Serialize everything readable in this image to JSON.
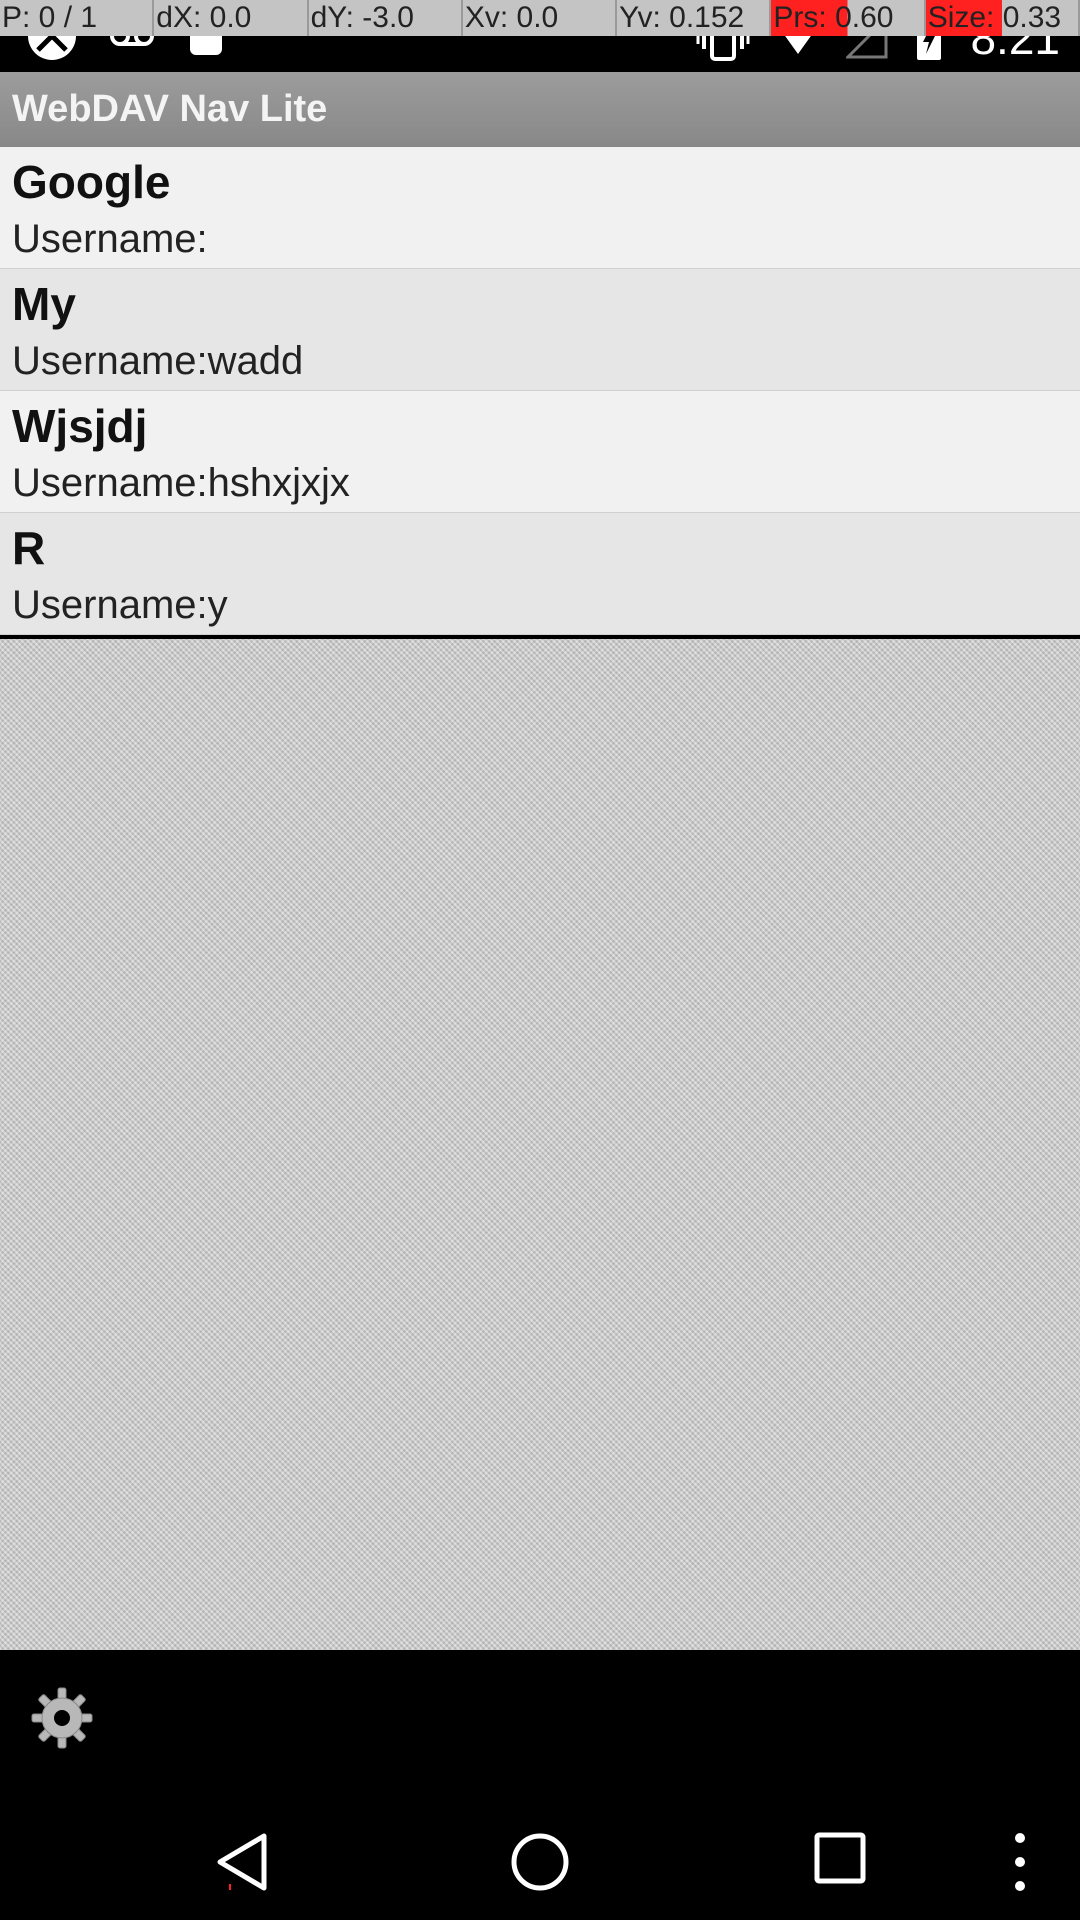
{
  "debug_overlay": [
    "P: 0 / 1",
    "dX: 0.0",
    "dY: -3.0",
    "Xv: 0.0",
    "Yv: 0.152",
    "Prs: 0.60",
    "Size: 0.33"
  ],
  "status_bar": {
    "time": "8:21",
    "left_icons": [
      "app-icon",
      "voicemail-icon",
      "android-icon"
    ],
    "right_icons": [
      "vibrate-icon",
      "wifi-icon",
      "signal-icon",
      "battery-charging-icon"
    ]
  },
  "app": {
    "title": "WebDAV Nav Lite"
  },
  "accounts": [
    {
      "name": "Google",
      "username": "Username:"
    },
    {
      "name": "My",
      "username": "Username:wadd"
    },
    {
      "name": "Wjsjdj",
      "username": "Username:hshxjxjx"
    },
    {
      "name": "R",
      "username": "Username:y"
    }
  ],
  "bottom_bar": {
    "icon": "settings-gear-icon"
  },
  "nav_bar": {
    "icons": [
      "back-icon",
      "home-icon",
      "recents-icon",
      "overflow-menu-icon"
    ]
  },
  "colors": {
    "debug_hot": "#ff2020",
    "app_bar": "#909090",
    "item_odd": "#f1f1f1",
    "item_even": "#e6e6e6"
  }
}
